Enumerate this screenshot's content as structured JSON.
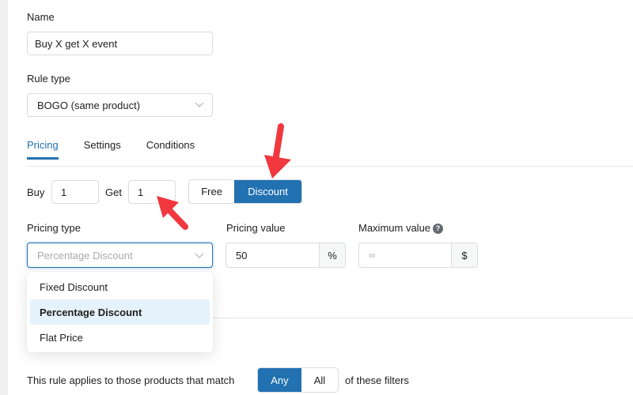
{
  "form": {
    "name_label": "Name",
    "name_value": "Buy X get X event",
    "rule_type_label": "Rule type",
    "rule_type_value": "BOGO (same product)"
  },
  "tabs": [
    {
      "label": "Pricing",
      "active": true
    },
    {
      "label": "Settings",
      "active": false
    },
    {
      "label": "Conditions",
      "active": false
    }
  ],
  "pricing": {
    "buy_label": "Buy",
    "buy_value": "1",
    "get_label": "Get",
    "get_value": "1",
    "reward_options": [
      {
        "label": "Free",
        "selected": false
      },
      {
        "label": "Discount",
        "selected": true
      }
    ],
    "pricing_type_label": "Pricing type",
    "pricing_type_value": "Percentage Discount",
    "pricing_type_options": [
      {
        "label": "Fixed Discount",
        "selected": false
      },
      {
        "label": "Percentage Discount",
        "selected": true
      },
      {
        "label": "Flat Price",
        "selected": false
      }
    ],
    "pricing_value_label": "Pricing value",
    "pricing_value": "50",
    "pricing_value_suffix": "%",
    "maximum_value_label": "Maximum value",
    "maximum_value_help": "?",
    "maximum_value_placeholder": "∞",
    "maximum_value_suffix": "$"
  },
  "filters": {
    "prefix": "This rule applies to those products that match",
    "match_options": [
      {
        "label": "Any",
        "selected": true
      },
      {
        "label": "All",
        "selected": false
      }
    ],
    "suffix": "of these filters"
  },
  "colors": {
    "accent": "#2271b1",
    "annotation_arrow": "#f0383e",
    "selected_option_bg": "#e5f1fb"
  }
}
